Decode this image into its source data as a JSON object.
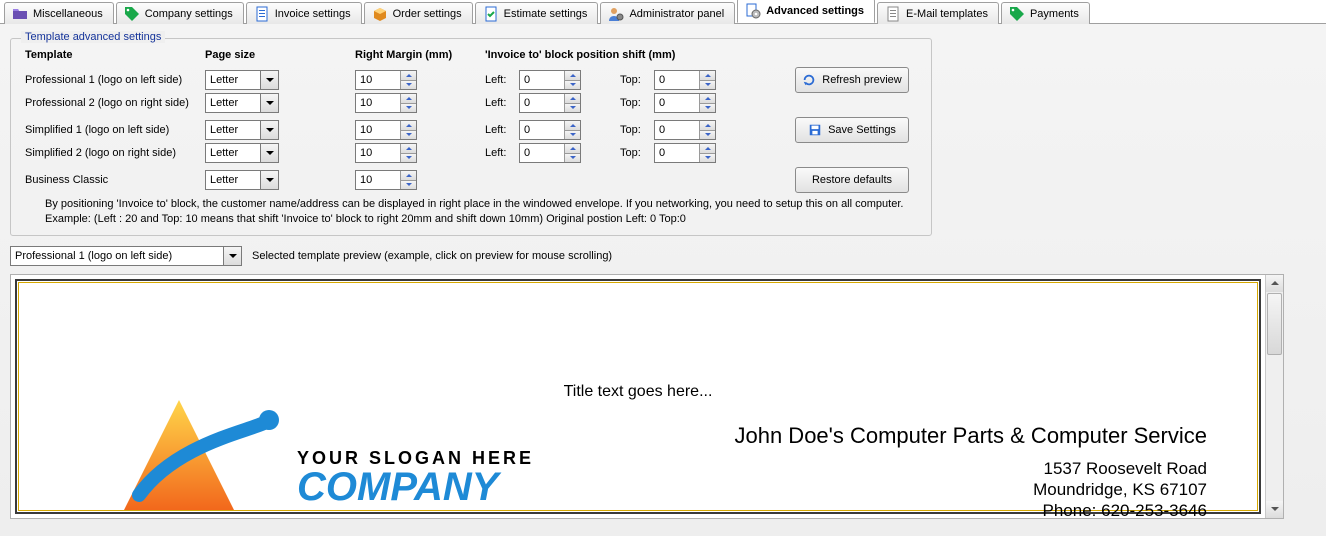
{
  "tabs": [
    {
      "label": "Miscellaneous"
    },
    {
      "label": "Company settings"
    },
    {
      "label": "Invoice settings"
    },
    {
      "label": "Order settings"
    },
    {
      "label": "Estimate settings"
    },
    {
      "label": "Administrator panel"
    },
    {
      "label": "Advanced settings"
    },
    {
      "label": "E-Mail templates"
    },
    {
      "label": "Payments"
    }
  ],
  "active_tab_index": 6,
  "group": {
    "title": "Template advanced settings",
    "headers": {
      "template": "Template",
      "page_size": "Page size",
      "right_margin": "Right Margin (mm)",
      "shift": "'Invoice to' block position shift (mm)"
    },
    "left_label": "Left:",
    "top_label": "Top:",
    "rows": [
      {
        "name": "Professional 1 (logo on left side)",
        "page_size": "Letter",
        "right_margin": "10",
        "left": "0",
        "top": "0"
      },
      {
        "name": "Professional 2 (logo on right side)",
        "page_size": "Letter",
        "right_margin": "10",
        "left": "0",
        "top": "0"
      },
      {
        "name": "Simplified 1 (logo on left side)",
        "page_size": "Letter",
        "right_margin": "10",
        "left": "0",
        "top": "0"
      },
      {
        "name": "Simplified 2 (logo on right side)",
        "page_size": "Letter",
        "right_margin": "10",
        "left": "0",
        "top": "0"
      },
      {
        "name": "Business Classic",
        "page_size": "Letter",
        "right_margin": "10"
      }
    ],
    "buttons": {
      "refresh": "Refresh preview",
      "save": "Save Settings",
      "restore": "Restore defaults"
    },
    "help_line1": "By positioning 'Invoice to' block, the customer name/address can be displayed in right place in the windowed envelope. If you networking, you need to setup this on all computer.",
    "help_line2": "Example:  (Left : 20 and Top: 10 means that shift 'Invoice to' block to right 20mm and shift down 10mm)  Original postion Left: 0 Top:0"
  },
  "selector": {
    "value": "Professional 1 (logo on left side)",
    "caption": "Selected template preview (example, click on preview for mouse scrolling)"
  },
  "preview": {
    "title": "Title text goes here...",
    "company": "John Doe's Computer Parts & Computer Service",
    "addr1": "1537 Roosevelt Road",
    "addr2": "Moundridge, KS 67107",
    "addr3": "Phone: 620-253-3646",
    "slogan": "YOUR SLOGAN HERE",
    "logo_word": "COMPANY"
  }
}
